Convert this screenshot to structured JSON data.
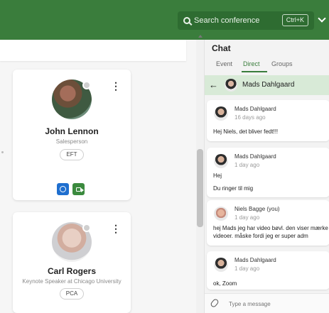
{
  "header": {
    "search_placeholder": "Search conference",
    "search_shortcut": "Ctrl+K",
    "colors": {
      "brand": "#3a7d3c"
    }
  },
  "attendees": [
    {
      "name": "John Lennon",
      "role": "Salesperson",
      "tag": "EFT"
    },
    {
      "name": "Carl Rogers",
      "role": "Keynote Speaker at Chicago University",
      "tag": "PCA"
    }
  ],
  "chat": {
    "title": "Chat",
    "tabs": [
      "Event",
      "Direct",
      "Groups"
    ],
    "active_tab": "Direct",
    "conversation_with": "Mads Dahlgaard",
    "messages": [
      {
        "sender": "Mads Dahlgaard",
        "time": "16 days ago",
        "lines": [
          "Hej Niels, det bliver fedt!!!"
        ]
      },
      {
        "sender": "Mads Dahlgaard",
        "time": "1 day ago",
        "lines": [
          "Hej",
          "Du ringer til mig"
        ]
      },
      {
        "sender": "Niels Bagge (you)",
        "time": "1 day ago",
        "lines": [
          "hej Mads jeg har video bøvl. den viser mærke",
          "videoer. måske fordi jeg er super adm"
        ]
      },
      {
        "sender": "Mads Dahlgaard",
        "time": "1 day ago",
        "lines": [
          "ok, Zoom"
        ]
      }
    ],
    "composer_placeholder": "Type a message"
  }
}
